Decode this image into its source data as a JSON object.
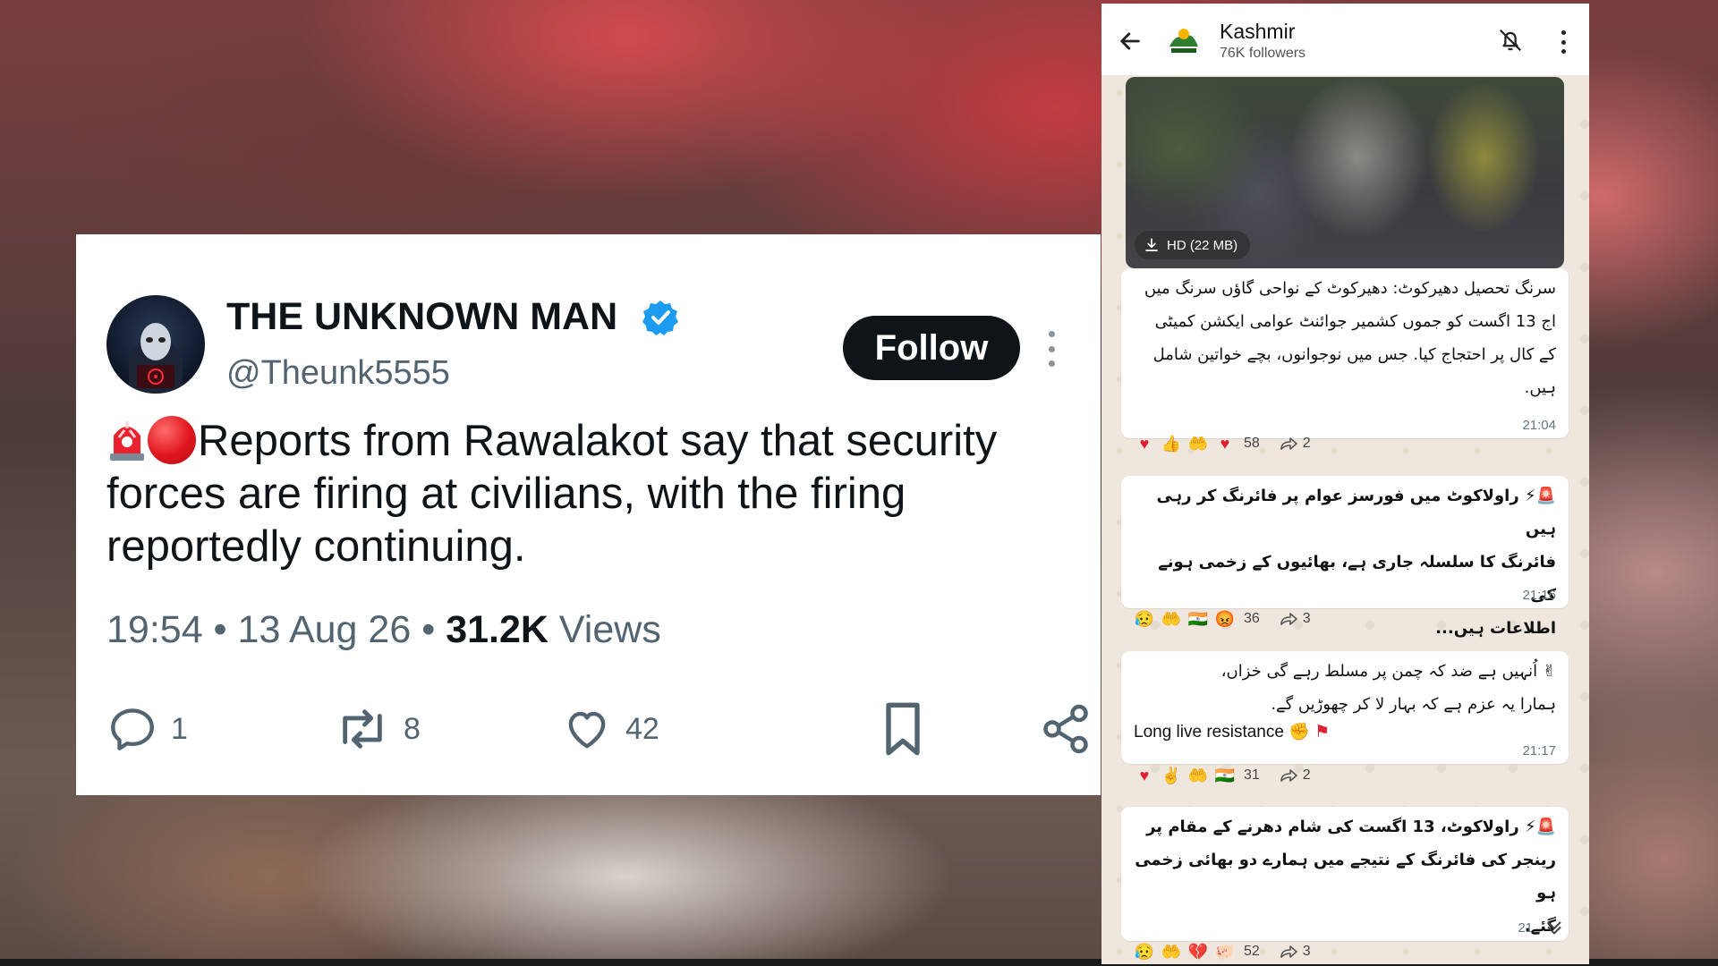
{
  "tweet": {
    "display_name": "THE UNKNOWN MAN",
    "handle": "@Theunk5555",
    "follow_label": "Follow",
    "body_text": "Reports from Rawalakot say that security forces are firing at civilians, with the firing reportedly continuing.",
    "time": "19:54 • 13 Aug 26 •",
    "views_count": "31.2K",
    "views_label": "Views",
    "actions": {
      "replies": "1",
      "reposts": "8",
      "likes": "42"
    },
    "colors": {
      "verified": "#1d9bf0",
      "follow_bg": "#0f1419",
      "muted": "#536471"
    }
  },
  "channel": {
    "name": "Kashmir",
    "followers": "76K followers",
    "video_size": "HD (22 MB)",
    "messages": [
      {
        "text_lines": [
          "سرنگ تحصیل دھیرکوٹ: دھیرکوٹ کے نواحی گاؤں سرنگ  میں",
          "اج 13 اگست کو جموں کشمیر جوائنٹ عوامی ایکشن کمیٹی",
          "کے کال پر احتجاج کیا. جس میں نوجوانوں، بچے خواتین شامل",
          "ہیں."
        ],
        "time": "21:04",
        "reaction_count": "58",
        "forward_count": "2"
      },
      {
        "text_lines": [
          "🚨⚡ راولاکوٹ میں فورسز عوام پر فائرنگ کر رہی ہیں",
          "فائرنگ کا سلسلہ جاری ہے، بھائیوں کے زخمی ہونے کی",
          "اطلاعات ہیں..."
        ],
        "time": "21:16",
        "reaction_count": "36",
        "forward_count": "3"
      },
      {
        "text_lines": [
          "✌ اُنہیں ہے ضد کہ چمن پر مسلط رہے گی خزاں،",
          "ہمارا یہ عزم ہے کہ بہار لا کر چھوڑیں گے."
        ],
        "ltr_line": "Long live resistance",
        "time": "21:17",
        "reaction_count": "31",
        "forward_count": "2"
      },
      {
        "text_lines": [
          "🚨⚡ راولاکوٹ، 13 اگست کی شام دھرنے کے مقام پر",
          "رینجر کی فائرنگ کے نتیجے میں ہمارے دو  بھائی زخمی ہو",
          "گئے."
        ],
        "time": "21",
        "reaction_count": "52",
        "forward_count": "3"
      }
    ]
  }
}
